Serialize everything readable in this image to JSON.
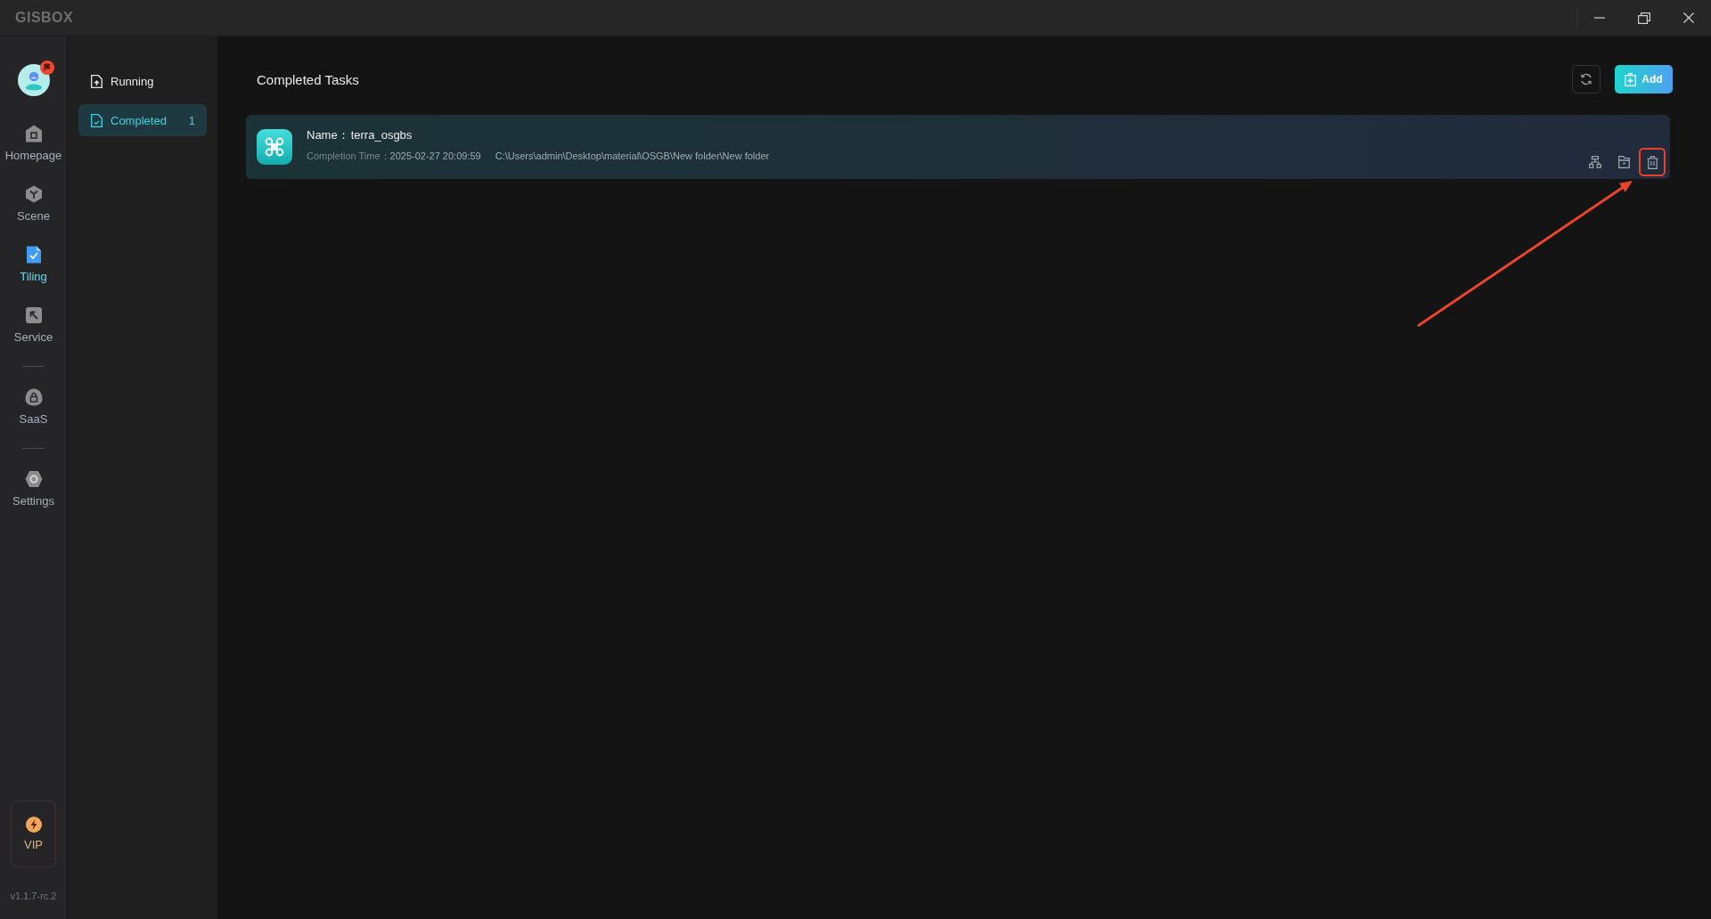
{
  "window": {
    "logo": "GISBOX",
    "controls": [
      {
        "kind": "minimize"
      },
      {
        "kind": "restore"
      },
      {
        "kind": "close"
      }
    ]
  },
  "sidebar": {
    "avatar": {
      "badge": true
    },
    "groups": [
      [
        {
          "kind": "home",
          "label": "Homepage",
          "selected": false
        },
        {
          "kind": "scene",
          "label": "Scene",
          "selected": false
        },
        {
          "kind": "tiling",
          "label": "Tiling",
          "selected": true
        },
        {
          "kind": "service",
          "label": "Service",
          "selected": false
        }
      ],
      [
        {
          "kind": "saas",
          "label": "SaaS",
          "selected": false
        }
      ],
      [
        {
          "kind": "settings",
          "label": "Settings",
          "selected": false
        }
      ]
    ],
    "vip": {
      "label": "VIP"
    },
    "version": "v1.1.7-rc.2"
  },
  "subnav": {
    "items": [
      {
        "kind": "running",
        "label": "Running",
        "selected": false
      },
      {
        "kind": "completed",
        "label": "Completed",
        "selected": true,
        "count": "1"
      }
    ]
  },
  "main": {
    "title": "Completed Tasks",
    "add_label": "Add",
    "tasks": [
      {
        "name_label": "Name：",
        "name": "terra_osgbs",
        "time_label": "Completion Time：",
        "time": "2025-02-27 20:09:59",
        "path": "C:\\Users\\admin\\Desktop\\material\\OSGB\\New folder\\New folder",
        "actions": [
          {
            "kind": "structure",
            "highlighted": false
          },
          {
            "kind": "folder",
            "highlighted": false
          },
          {
            "kind": "delete",
            "highlighted": true
          }
        ]
      }
    ]
  }
}
